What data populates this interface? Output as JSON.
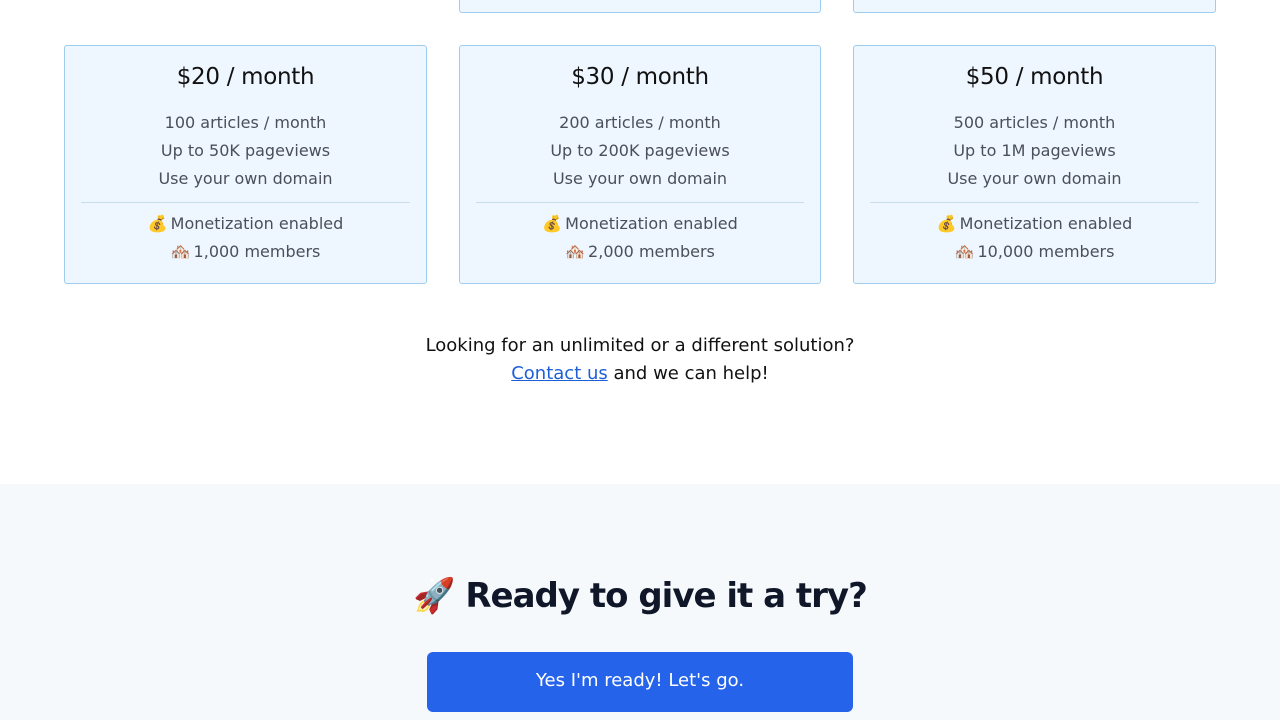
{
  "plans": [
    {
      "price": "$20 / month",
      "articles": "100 articles / month",
      "pageviews": "Up to 50K pageviews",
      "domain": "Use your own domain",
      "monetization_icon": "💰",
      "monetization": "Monetization enabled",
      "members_icon": "🏘️",
      "members": "1,000 members"
    },
    {
      "price": "$30 / month",
      "articles": "200 articles / month",
      "pageviews": "Up to 200K pageviews",
      "domain": "Use your own domain",
      "monetization_icon": "💰",
      "monetization": "Monetization enabled",
      "members_icon": "🏘️",
      "members": "2,000 members"
    },
    {
      "price": "$50 / month",
      "articles": "500 articles / month",
      "pageviews": "Up to 1M pageviews",
      "domain": "Use your own domain",
      "monetization_icon": "💰",
      "monetization": "Monetization enabled",
      "members_icon": "🏘️",
      "members": "10,000 members"
    }
  ],
  "contact": {
    "line1": "Looking for an unlimited or a different solution?",
    "link": "Contact us",
    "line2_rest": " and we can help!"
  },
  "cta": {
    "icon": "🚀",
    "title": "Ready to give it a try?",
    "button": "Yes I'm ready! Let's go."
  },
  "colors": {
    "card_bg": "#eef6ff",
    "card_border": "#9fcdef",
    "link": "#1d5fd6",
    "button": "#2563eb",
    "section_bg": "#f6f9fc"
  }
}
